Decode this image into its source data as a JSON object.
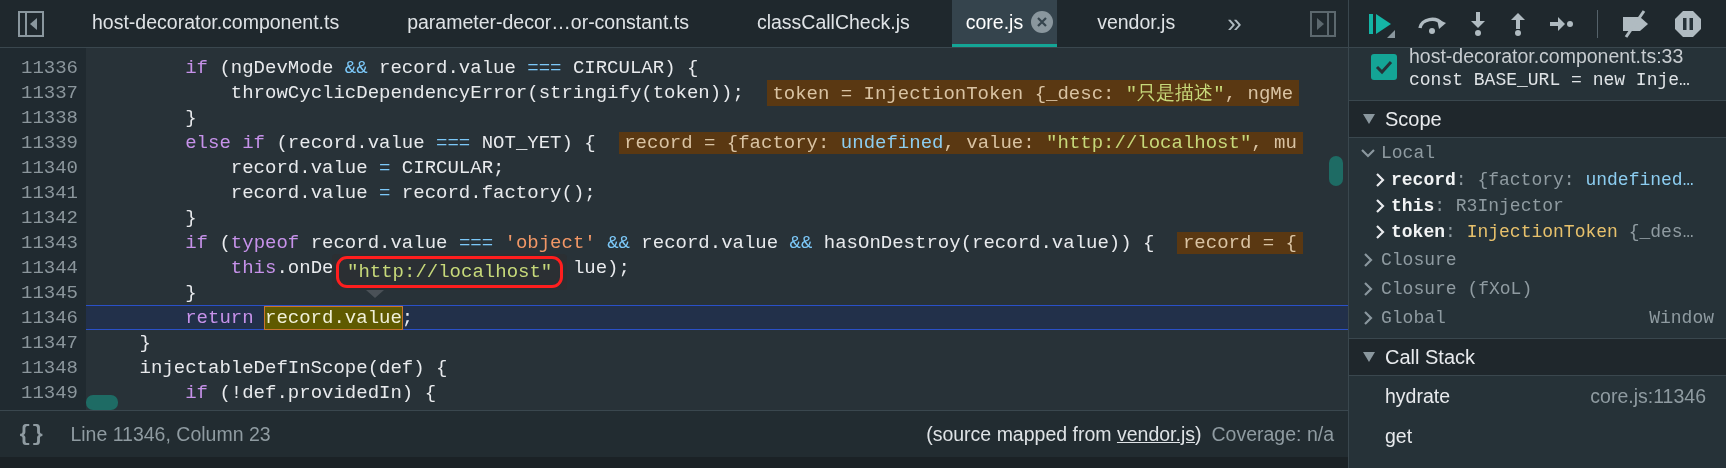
{
  "editor_tabs": [
    {
      "label": "host-decorator.component.ts",
      "selected": false
    },
    {
      "label": "parameter-decor…or-constant.ts",
      "selected": false
    },
    {
      "label": "classCallCheck.js",
      "selected": false
    },
    {
      "label": "core.js",
      "selected": true
    },
    {
      "label": "vendor.js",
      "selected": false
    }
  ],
  "overflow_button": "»",
  "code_lines": [
    {
      "number": "11336",
      "tokens": [
        {
          "kind": "keyword",
          "text": "        if"
        },
        {
          "kind": "plain",
          "text": " (ngDevMode "
        },
        {
          "kind": "operator",
          "text": "&&"
        },
        {
          "kind": "plain",
          "text": " record.value "
        },
        {
          "kind": "operator",
          "text": "==="
        },
        {
          "kind": "plain",
          "text": " CIRCULAR) {"
        }
      ]
    },
    {
      "number": "11337",
      "tokens": [
        {
          "kind": "plain",
          "text": "            throwCyclicDependencyError(stringify(token));"
        }
      ],
      "inline_value": [
        {
          "kind": "plain",
          "text": "token = InjectionToken {_desc: "
        },
        {
          "kind": "string",
          "text": "\"只是描述\""
        },
        {
          "kind": "plain",
          "text": ", ngMe"
        }
      ]
    },
    {
      "number": "11338",
      "tokens": [
        {
          "kind": "plain",
          "text": "        }"
        }
      ]
    },
    {
      "number": "11339",
      "tokens": [
        {
          "kind": "keyword",
          "text": "        else if"
        },
        {
          "kind": "plain",
          "text": " (record.value "
        },
        {
          "kind": "operator",
          "text": "==="
        },
        {
          "kind": "plain",
          "text": " NOT_YET) {"
        }
      ],
      "inline_value": [
        {
          "kind": "plain",
          "text": "record = {factory: "
        },
        {
          "kind": "undefined",
          "text": "undefined"
        },
        {
          "kind": "plain",
          "text": ", value: "
        },
        {
          "kind": "string",
          "text": "\"http://localhost\""
        },
        {
          "kind": "plain",
          "text": ", mu"
        }
      ]
    },
    {
      "number": "11340",
      "tokens": [
        {
          "kind": "plain",
          "text": "            record.value "
        },
        {
          "kind": "operator",
          "text": "="
        },
        {
          "kind": "plain",
          "text": " CIRCULAR;"
        }
      ]
    },
    {
      "number": "11341",
      "tokens": [
        {
          "kind": "plain",
          "text": "            record.value "
        },
        {
          "kind": "operator",
          "text": "="
        },
        {
          "kind": "plain",
          "text": " record.factory();"
        }
      ]
    },
    {
      "number": "11342",
      "tokens": [
        {
          "kind": "plain",
          "text": "        }"
        }
      ]
    },
    {
      "number": "11343",
      "tokens": [
        {
          "kind": "keyword",
          "text": "        if"
        },
        {
          "kind": "plain",
          "text": " ("
        },
        {
          "kind": "keyword",
          "text": "typeof"
        },
        {
          "kind": "plain",
          "text": " record.value "
        },
        {
          "kind": "operator",
          "text": "==="
        },
        {
          "kind": "literal",
          "text": " 'object'"
        },
        {
          "kind": "operator",
          "text": " &&"
        },
        {
          "kind": "plain",
          "text": " record.value "
        },
        {
          "kind": "operator",
          "text": "&&"
        },
        {
          "kind": "plain",
          "text": " hasOnDestroy(record.value)) {"
        }
      ],
      "inline_value": [
        {
          "kind": "plain",
          "text": "record = {"
        }
      ]
    },
    {
      "number": "11344",
      "tokens": [
        {
          "kind": "keyword",
          "text": "            this"
        },
        {
          "kind": "plain",
          "text": ".onDe"
        },
        {
          "kind": "covered"
        },
        {
          "kind": "plain",
          "text": "lue);"
        }
      ]
    },
    {
      "number": "11345",
      "tokens": [
        {
          "kind": "plain",
          "text": "        }"
        }
      ]
    },
    {
      "number": "11346",
      "current": true,
      "tokens": [
        {
          "kind": "keyword",
          "text": "        return"
        },
        {
          "kind": "evaluated",
          "text": "record.value"
        },
        {
          "kind": "plain",
          "text": ";"
        }
      ]
    },
    {
      "number": "11347",
      "tokens": [
        {
          "kind": "plain",
          "text": "    }"
        }
      ]
    },
    {
      "number": "11348",
      "tokens": [
        {
          "kind": "plain",
          "text": "    injectableDefInScope(def) {"
        }
      ]
    },
    {
      "number": "11349",
      "tokens": [
        {
          "kind": "keyword",
          "text": "        if"
        },
        {
          "kind": "plain",
          "text": " (!def.providedIn) {"
        }
      ]
    }
  ],
  "popover": {
    "value": "\"http://localhost\""
  },
  "status_bar": {
    "pretty_print": "{}",
    "cursor_position": "Line 11346, Column 23",
    "source_map": {
      "prefix": "(source mapped from ",
      "link": "vendor.js",
      "suffix": ")"
    },
    "coverage": "Coverage: n/a"
  },
  "breakpoint": {
    "checked": true,
    "location": "host-decorator.component.ts:33",
    "code": "const BASE_URL = new Inje…"
  },
  "scope": {
    "title": "Scope",
    "expanded": true,
    "groups": [
      {
        "name": "Local",
        "expanded": true,
        "variables": [
          {
            "name": "record",
            "value": [
              {
                "kind": "plain",
                "text": ": {factory: "
              },
              {
                "kind": "undefined",
                "text": "undefined…"
              }
            ]
          },
          {
            "name": "this",
            "value": [
              {
                "kind": "plain",
                "text": ": R3Injector"
              }
            ]
          },
          {
            "name": "token",
            "value": [
              {
                "kind": "plain",
                "text": ": "
              },
              {
                "kind": "class",
                "text": "InjectionToken"
              },
              {
                "kind": "plain",
                "text": " {_des…"
              }
            ]
          }
        ]
      },
      {
        "name": "Closure",
        "expanded": false
      },
      {
        "name": "Closure (fXoL)",
        "expanded": false
      },
      {
        "name": "Global",
        "expanded": false,
        "value": "Window"
      }
    ]
  },
  "call_stack": {
    "title": "Call Stack",
    "expanded": true,
    "frames": [
      {
        "function": "hydrate",
        "location": "core.js:11346"
      },
      {
        "function": "get"
      }
    ]
  }
}
